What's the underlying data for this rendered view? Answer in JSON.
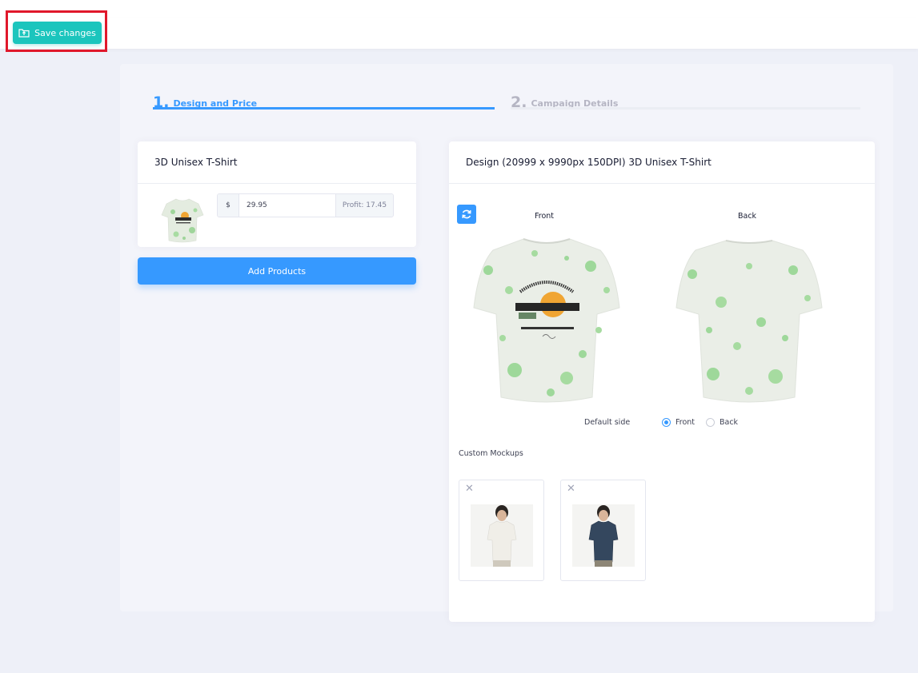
{
  "toolbar": {
    "save_label": "Save changes"
  },
  "steps": [
    {
      "num": "1.",
      "label": "Design and Price"
    },
    {
      "num": "2.",
      "label": "Campaign Details"
    }
  ],
  "product": {
    "title": "3D Unisex T-Shirt",
    "currency": "$",
    "price": "29.95",
    "profit": "Profit: 17.45"
  },
  "add_products_label": "Add Products",
  "design": {
    "title": "Design (20999 x 9990px 150DPI) 3D Unisex T-Shirt",
    "front_label": "Front",
    "back_label": "Back",
    "default_side_label": "Default side",
    "radio_front": "Front",
    "radio_back": "Back",
    "selected_side": "Front",
    "custom_mockups_label": "Custom Mockups"
  },
  "colors": {
    "accent": "#3699ff",
    "save": "#1bc5bd",
    "highlight": "#e0182b"
  }
}
